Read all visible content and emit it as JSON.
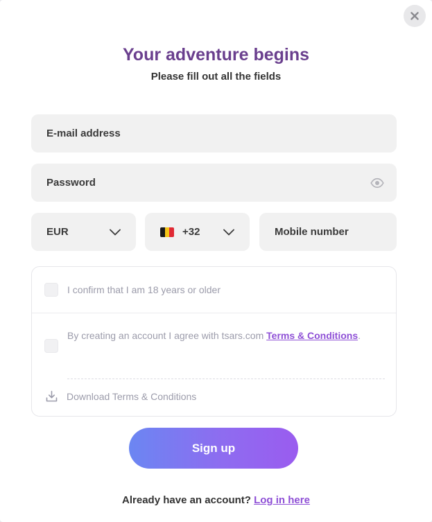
{
  "header": {
    "title": "Your adventure begins",
    "subtitle": "Please fill out all the fields"
  },
  "form": {
    "email_placeholder": "E-mail address",
    "password_placeholder": "Password",
    "currency_value": "EUR",
    "phone_code_value": "+32",
    "phone_flag": "belgium-flag",
    "mobile_placeholder": "Mobile number"
  },
  "consent": {
    "age_text": "I confirm that I am 18 years or older",
    "terms_prefix": "By creating an account I agree with tsars.com ",
    "terms_link": "Terms & Conditions",
    "terms_suffix": ".",
    "download_label": "Download Terms & Conditions"
  },
  "actions": {
    "signup_label": "Sign up",
    "login_prompt": "Already have an account?",
    "login_link": "Log in here"
  },
  "icons": {
    "close": "close-icon",
    "eye": "eye-icon",
    "chevron": "chevron-down-icon",
    "download": "download-icon"
  },
  "colors": {
    "title": "#6a3f8e",
    "link": "#8e4fd6",
    "field_bg": "#f1f1f1",
    "button_gradient_start": "#6b86f2",
    "button_gradient_end": "#9a5cef"
  }
}
